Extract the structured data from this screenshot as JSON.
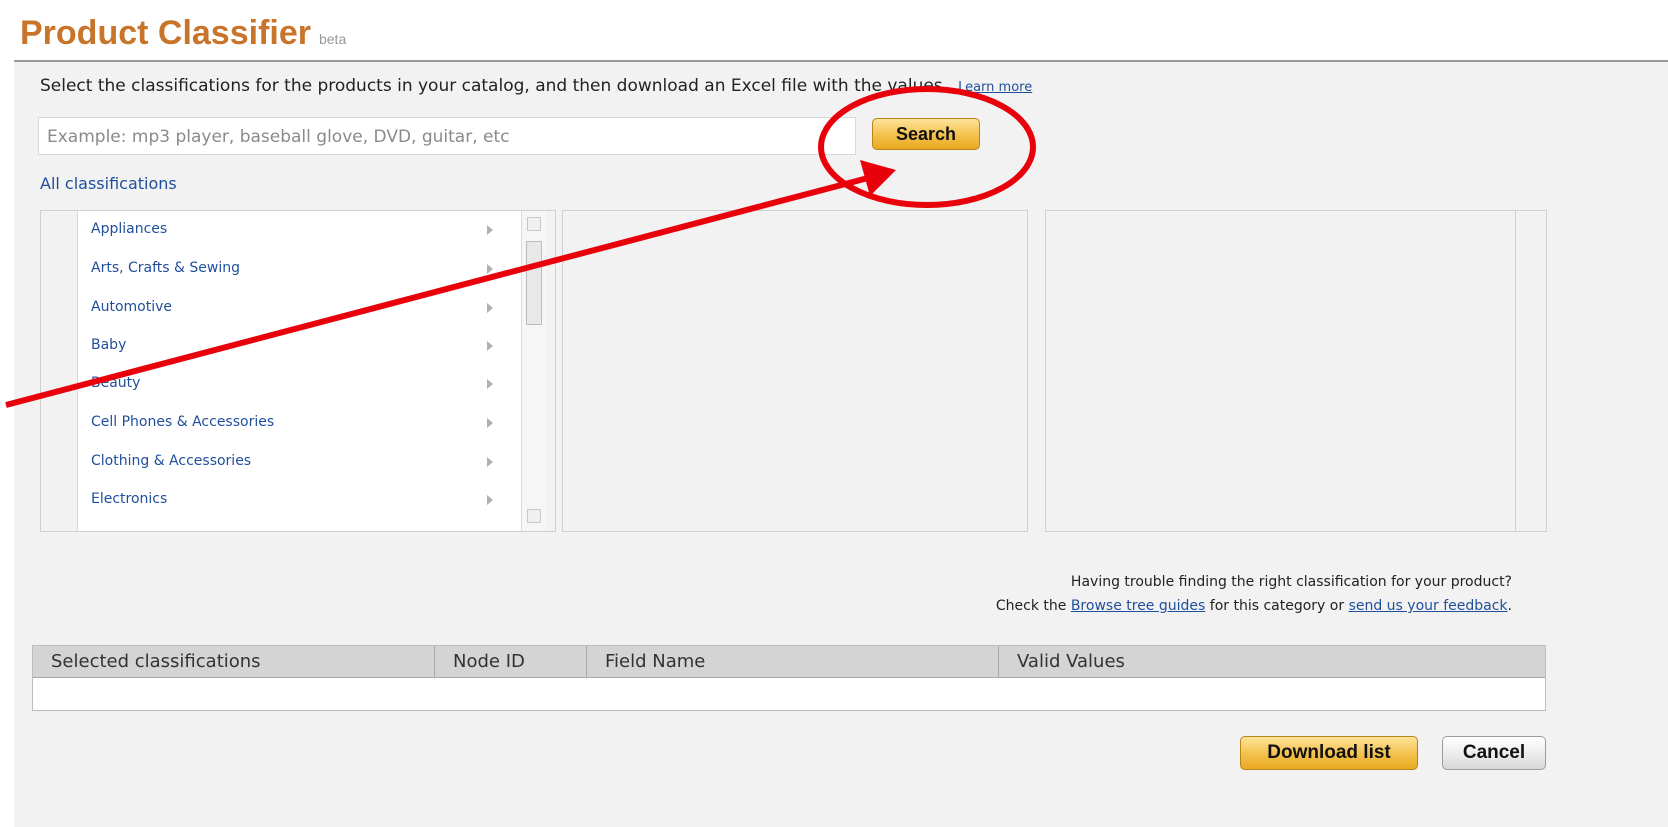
{
  "header": {
    "title": "Product Classifier",
    "badge": "beta"
  },
  "intro": {
    "text": "Select the classifications for the products in your catalog, and then download an Excel file with the values.",
    "learn_more": "Learn more"
  },
  "search": {
    "placeholder": "Example: mp3 player, baseball glove, DVD, guitar, etc",
    "button": "Search"
  },
  "all_classifications": "All classifications",
  "categories": [
    "Appliances",
    "Arts, Crafts & Sewing",
    "Automotive",
    "Baby",
    "Beauty",
    "Cell Phones & Accessories",
    "Clothing & Accessories",
    "Electronics"
  ],
  "help": {
    "line1": "Having trouble finding the right classification for your product?",
    "line2_prefix": "Check the",
    "browse_link": "Browse tree guides",
    "line2_middle": "for this category or",
    "feedback_link": "send us your feedback",
    "line2_suffix": "."
  },
  "table": {
    "headers": [
      "Selected classifications",
      "Node ID",
      "Field Name",
      "Valid Values"
    ]
  },
  "actions": {
    "download": "Download list",
    "cancel": "Cancel"
  },
  "colors": {
    "accent": "#c8742a",
    "link": "#1f4f9c",
    "annotation": "#e8000b",
    "button_gold": "#f3c04b"
  }
}
